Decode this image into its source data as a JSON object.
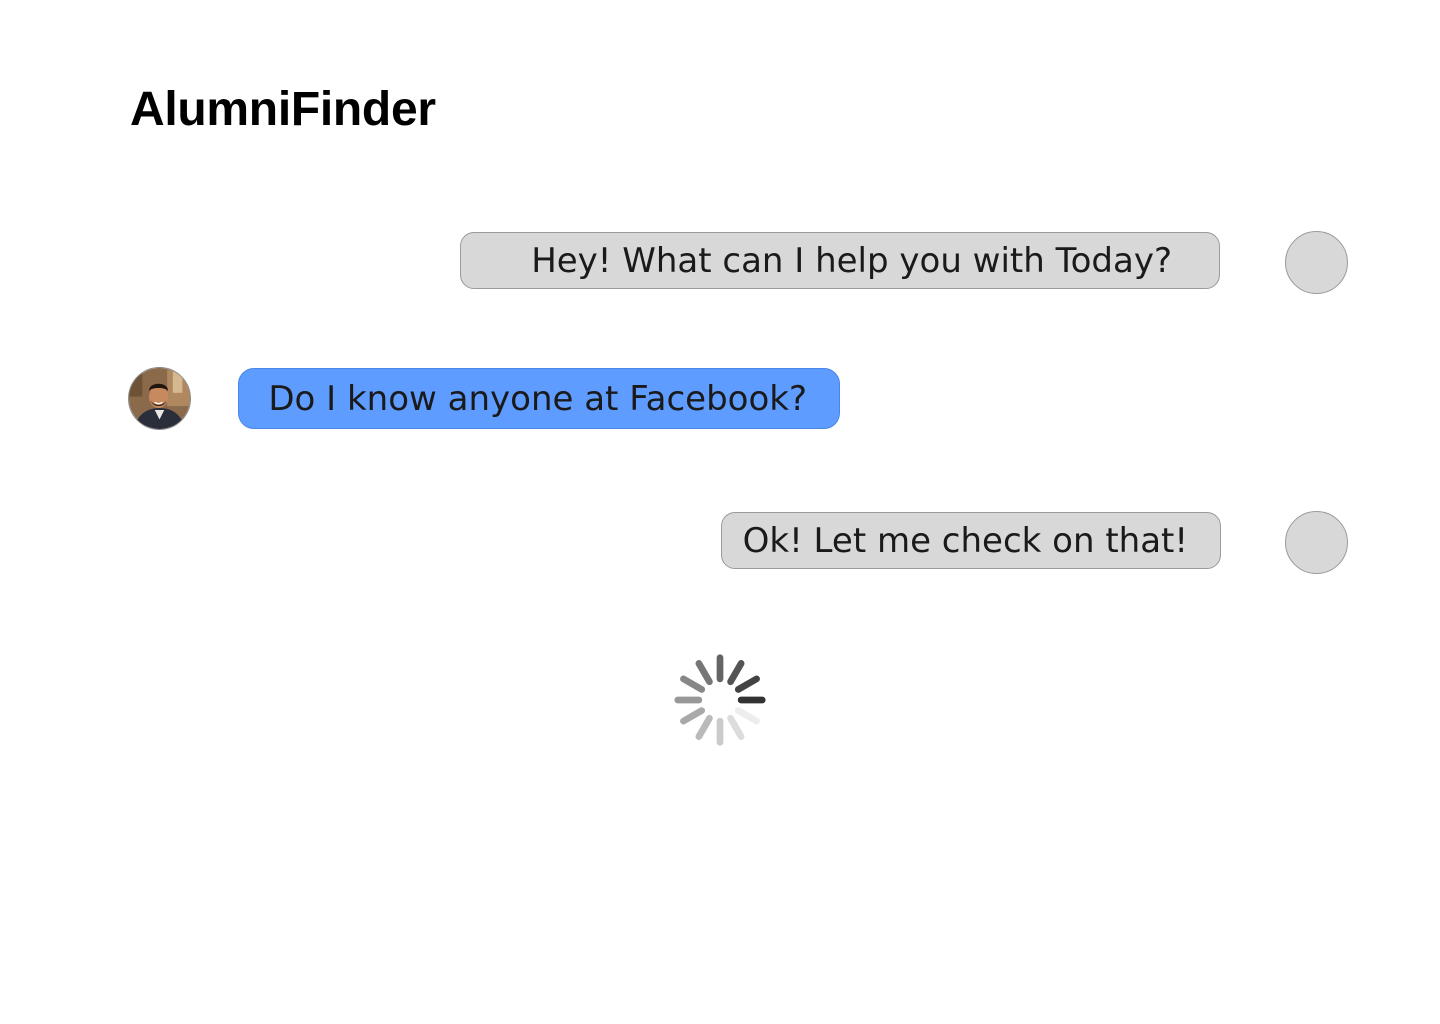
{
  "app": {
    "title": "AlumniFinder"
  },
  "chat": {
    "messages": [
      {
        "sender": "bot",
        "text": "Hey! What can I help you with Today?"
      },
      {
        "sender": "user",
        "text": "Do I know anyone at Facebook?"
      },
      {
        "sender": "bot",
        "text": "Ok! Let me check on that!"
      }
    ],
    "loading_indicator": "spinner-icon"
  },
  "colors": {
    "bot_bubble": "#d8d8d8",
    "user_bubble": "#5f9cff",
    "background": "#ffffff"
  }
}
